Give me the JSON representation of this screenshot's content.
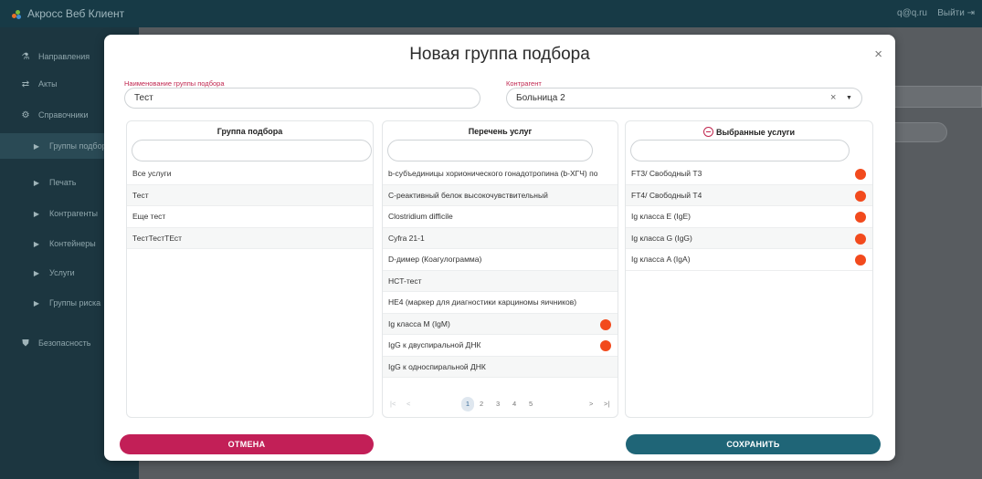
{
  "app": {
    "title": "Акросс Веб Клиент",
    "user": "q@q.ru",
    "logout": "Выйти"
  },
  "sidebar": {
    "items": [
      {
        "label": "Направления",
        "icon": "flask-icon"
      },
      {
        "label": "Акты",
        "icon": "transfer-icon"
      },
      {
        "label": "Справочники",
        "icon": "gear-icon"
      },
      {
        "label": "Группы подбора",
        "icon": "caret-right-icon"
      },
      {
        "label": "Печать",
        "icon": "caret-right-icon"
      },
      {
        "label": "Контрагенты",
        "icon": "caret-right-icon"
      },
      {
        "label": "Контейнеры",
        "icon": "caret-right-icon"
      },
      {
        "label": "Услуги",
        "icon": "caret-right-icon"
      },
      {
        "label": "Группы риска",
        "icon": "caret-right-icon"
      },
      {
        "label": "Безопасность",
        "icon": "shield-icon"
      }
    ]
  },
  "modal": {
    "title": "Новая группа подбора",
    "close": "×",
    "group_name": {
      "label": "Наименование группы подбора",
      "value": "Тест"
    },
    "contractor": {
      "label": "Контрагент",
      "value": "Больница 2",
      "clear": "×",
      "caret": "▼"
    },
    "panels": {
      "groups": {
        "title": "Группа подбора",
        "items": [
          "Все услуги",
          "Тест",
          "Еще тест",
          "ТестТестТЕст"
        ]
      },
      "services": {
        "title": "Перечень услуг",
        "items": [
          {
            "label": "b-субъединицы хорионического гонадотропина (b-ХГЧ) по",
            "selected": false
          },
          {
            "label": "С-реактивный белок высокочувствительный",
            "selected": false
          },
          {
            "label": "Clostridium difficile",
            "selected": false
          },
          {
            "label": "Cyfra 21-1",
            "selected": false
          },
          {
            "label": "D-димер (Коагулограмма)",
            "selected": false
          },
          {
            "label": "HCT-тест",
            "selected": false
          },
          {
            "label": "HE4 (маркер для диагностики карциномы яичников)",
            "selected": false
          },
          {
            "label": "Ig класса M (IgM)",
            "selected": true
          },
          {
            "label": "IgG к двуспиральной ДНК",
            "selected": true
          },
          {
            "label": "IgG к односпиральной ДНК",
            "selected": false
          }
        ],
        "pager": {
          "first": "|<",
          "prev": "<",
          "pages": [
            "1",
            "2",
            "3",
            "4",
            "5"
          ],
          "current": "1",
          "next": ">",
          "last": ">|"
        }
      },
      "selected": {
        "title": "Выбранные услуги",
        "items": [
          "FT3/ Свободный Т3",
          "FT4/ Свободный Т4",
          "Ig класса E (IgE)",
          "Ig класса G (IgG)",
          "Ig класса A (IgA)"
        ]
      }
    },
    "buttons": {
      "cancel": "ОТМЕНА",
      "save": "СОХРАНИТЬ"
    }
  },
  "colors": {
    "accent": "#c21f57",
    "primary": "#1f6577",
    "marker": "#f24a1d"
  }
}
